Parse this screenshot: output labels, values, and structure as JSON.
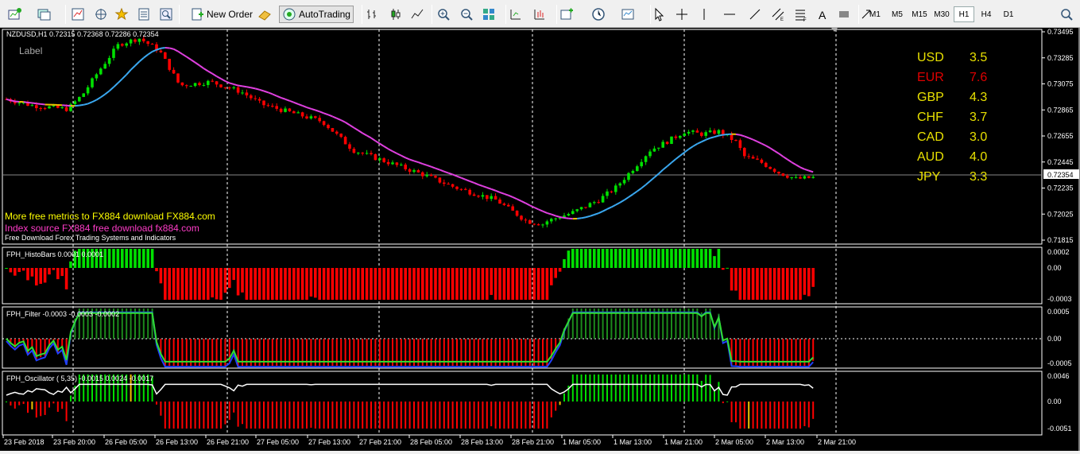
{
  "toolbar": {
    "new_order_label": "New Order",
    "autotrading_label": "AutoTrading",
    "timeframes": [
      "M1",
      "M5",
      "M15",
      "M30",
      "H1",
      "H4",
      "D1"
    ],
    "active_timeframe": "H1",
    "icons": [
      "new-chart-icon",
      "profiles-icon",
      "market-watch-icon",
      "navigator-icon",
      "favorites-icon",
      "data-window-icon",
      "strategy-tester-icon",
      "new-order-icon",
      "metaeditor-icon",
      "autotrading-icon",
      "bar-chart-icon",
      "candlestick-icon",
      "line-chart-icon",
      "zoom-in-icon",
      "zoom-out-icon",
      "tile-windows-icon",
      "chart-shift-icon",
      "auto-scroll-icon",
      "indicators-icon",
      "periods-icon",
      "templates-icon",
      "cursor-icon",
      "crosshair-icon",
      "vertical-line-icon",
      "horizontal-line-icon",
      "trendline-icon",
      "equidistant-channel-icon",
      "fibonacci-icon",
      "text-icon",
      "text-label-icon",
      "arrows-icon",
      "search-icon"
    ]
  },
  "main_chart": {
    "title": "NZDUSD,H1 0.72315 0.72368 0.72286 0.72354",
    "label_text": "Label",
    "price_labels": [
      "0.73495",
      "0.73285",
      "0.73075",
      "0.72865",
      "0.72655",
      "0.72445",
      "0.72235",
      "0.72025",
      "0.71815"
    ],
    "current_price": "0.72354",
    "promo_lines": [
      "More free metrics to FX884 download FX884.com",
      "Index source FX884 free download fx884.com",
      "Free Download Forex Trading Systems and Indicators"
    ],
    "currency_strength": [
      {
        "currency": "USD",
        "value": "3.5",
        "color": "#e8e000"
      },
      {
        "currency": "EUR",
        "value": "7.6",
        "color": "#e00000"
      },
      {
        "currency": "GBP",
        "value": "4.3",
        "color": "#e8e000"
      },
      {
        "currency": "CHF",
        "value": "3.7",
        "color": "#e8e000"
      },
      {
        "currency": "CAD",
        "value": "3.0",
        "color": "#e8e000"
      },
      {
        "currency": "AUD",
        "value": "4.0",
        "color": "#e8e000"
      },
      {
        "currency": "JPY",
        "value": "3.3",
        "color": "#e8e000"
      }
    ]
  },
  "histobars": {
    "title": "FPH_HistoBars 0.0001 0.0001",
    "labels": [
      "0.0002",
      "0.00",
      "-0.0003"
    ]
  },
  "filter": {
    "title": "FPH_Filter -0.0003 -0.0003 -0.0002",
    "labels": [
      "0.0005",
      "0.00",
      "-0.0005"
    ]
  },
  "oscillator": {
    "title": "FPH_Oscillator ( 5,35) -0.0015 0.0024 -0.0017",
    "labels": [
      "0.0046",
      "0.00",
      "-0.0051"
    ]
  },
  "time_axis": [
    "23 Feb 2018",
    "23 Feb 20:00",
    "26 Feb 05:00",
    "26 Feb 13:00",
    "26 Feb 21:00",
    "27 Feb 05:00",
    "27 Feb 13:00",
    "27 Feb 21:00",
    "28 Feb 05:00",
    "28 Feb 13:00",
    "28 Feb 21:00",
    "1 Mar 05:00",
    "1 Mar 13:00",
    "1 Mar 21:00",
    "2 Mar 05:00",
    "2 Mar 13:00",
    "2 Mar 21:00"
  ],
  "colors": {
    "bull": "#00e000",
    "bear": "#ff0000",
    "ma_pink": "#e040e0",
    "ma_blue": "#3aa8f0",
    "ma_yellow": "#f0c000",
    "grid": "#ffffff",
    "promo1": "#ffff00",
    "promo2": "#ff3cc8"
  }
}
